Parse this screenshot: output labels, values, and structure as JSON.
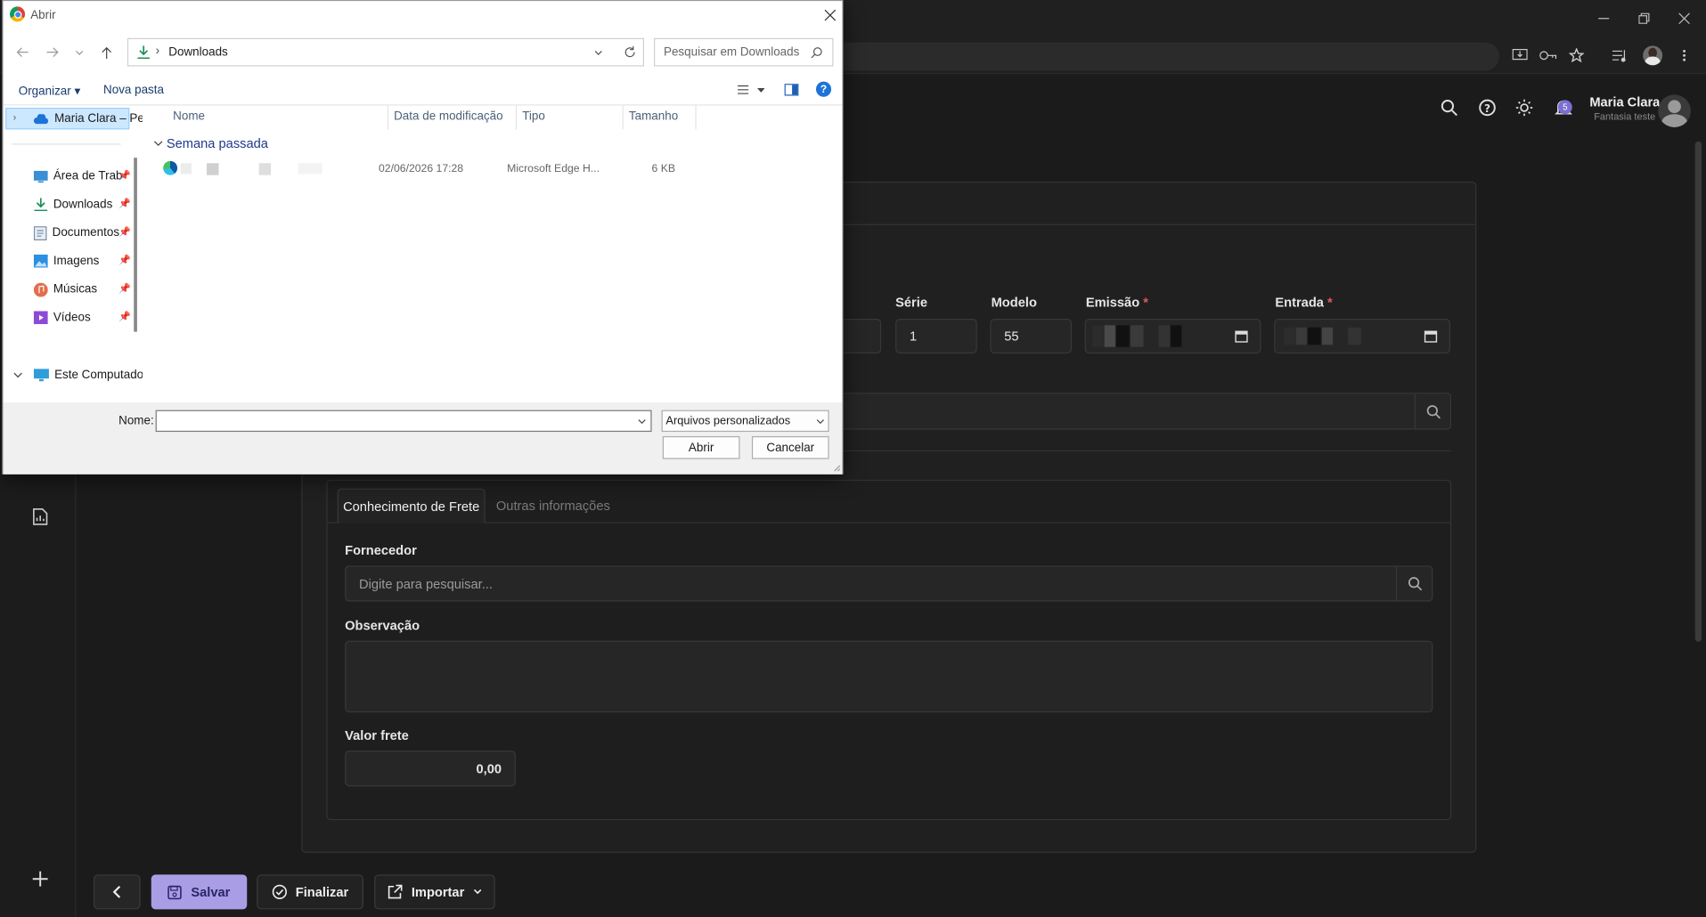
{
  "browser": {
    "avatar": "avatar",
    "icons": [
      "install-icon",
      "key-icon",
      "star-icon",
      "media-icon"
    ]
  },
  "header": {
    "user_name": "Maria Clara",
    "user_sub": "Fantasia teste",
    "notification_count": "5"
  },
  "form": {
    "serie_label": "Série",
    "serie_value": "1",
    "modelo_label": "Modelo",
    "modelo_value": "55",
    "emissao_label": "Emissão",
    "entrada_label": "Entrada",
    "required_mark": "*"
  },
  "tabs": {
    "active": "Conhecimento de Frete",
    "other": "Outras informações"
  },
  "freight": {
    "fornecedor_label": "Fornecedor",
    "fornecedor_placeholder": "Digite para pesquisar...",
    "observacao_label": "Observação",
    "valor_label": "Valor frete",
    "valor_value": "0,00"
  },
  "footer": {
    "save": "Salvar",
    "finalize": "Finalizar",
    "import": "Importar"
  },
  "dialog": {
    "title": "Abrir",
    "breadcrumb": "Downloads",
    "search_placeholder": "Pesquisar em Downloads",
    "organize": "Organizar",
    "new_folder": "Nova pasta",
    "columns": [
      "Nome",
      "Data de modificação",
      "Tipo",
      "Tamanho"
    ],
    "group": "Semana passada",
    "file": {
      "date": "02/06/2026 17:28",
      "type": "Microsoft Edge H...",
      "size": "6 KB"
    },
    "tree": {
      "cloud": "Maria Clara – Pe",
      "desktop": "Área de Trab",
      "downloads": "Downloads",
      "documents": "Documentos",
      "images": "Imagens",
      "music": "Músicas",
      "videos": "Vídeos",
      "computer": "Este Computado"
    },
    "name_label": "Nome:",
    "filter": "Arquivos personalizados",
    "open": "Abrir",
    "cancel": "Cancelar",
    "help": "?"
  }
}
